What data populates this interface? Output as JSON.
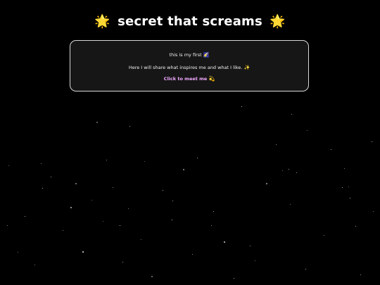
{
  "header": {
    "title": "secret that screams",
    "left_icon": "🌟",
    "right_icon": "🌟"
  },
  "card": {
    "intro_text": "this is my first",
    "intro_icon": "🌠",
    "description_text": "Here I will share what inspires me and what I like.",
    "description_icon": "✨",
    "cta_label": "Click to meet me",
    "cta_icon": "💫",
    "cta_color": "#f0a8ff"
  },
  "theme": {
    "background": "#000000",
    "card_background": "#161616",
    "card_border": "#d8d8d8"
  }
}
